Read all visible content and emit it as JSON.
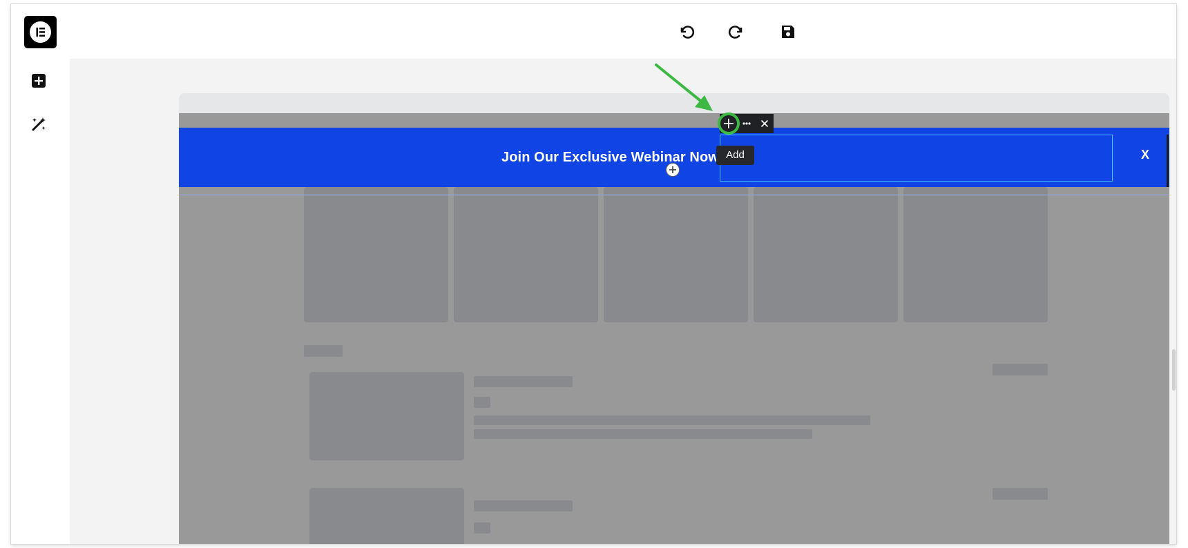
{
  "app": {
    "logo_icon": "elementor-logo-icon",
    "toolbar": {
      "undo_icon": "undo-icon",
      "redo_icon": "redo-icon",
      "save_icon": "save-icon"
    },
    "sidebar": {
      "add_icon": "add-element-icon",
      "ai_icon": "magic-wand-icon"
    }
  },
  "preview": {
    "banner": {
      "title": "Join Our Exclusive Webinar Now",
      "close_label": "X",
      "background_color": "#1044e4"
    },
    "element_toolbar": {
      "add_icon": "plus-icon",
      "more_icon": "more-icon",
      "close_icon": "close-icon"
    },
    "tooltip": "Add",
    "annotation_color": "#3db843"
  }
}
